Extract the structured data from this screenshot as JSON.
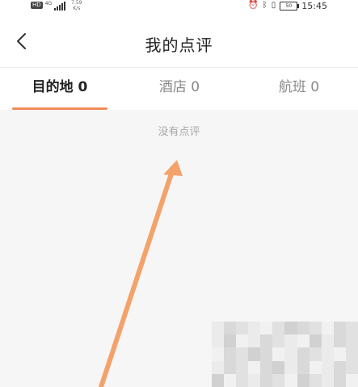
{
  "status_bar": {
    "hd_badge": "HD",
    "network_label": "4G",
    "speed_value": "7.59",
    "speed_unit": "K/s",
    "battery_level": "50",
    "time": "15:45"
  },
  "nav": {
    "title": "我的点评"
  },
  "tabs": [
    {
      "label": "目的地 0",
      "active": true
    },
    {
      "label": "酒店 0",
      "active": false
    },
    {
      "label": "航班 0",
      "active": false
    }
  ],
  "content": {
    "empty_message": "没有点评"
  },
  "colors": {
    "accent": "#f08a5a",
    "annotation_arrow": "#f4a26b",
    "background": "#f6f6f6"
  }
}
